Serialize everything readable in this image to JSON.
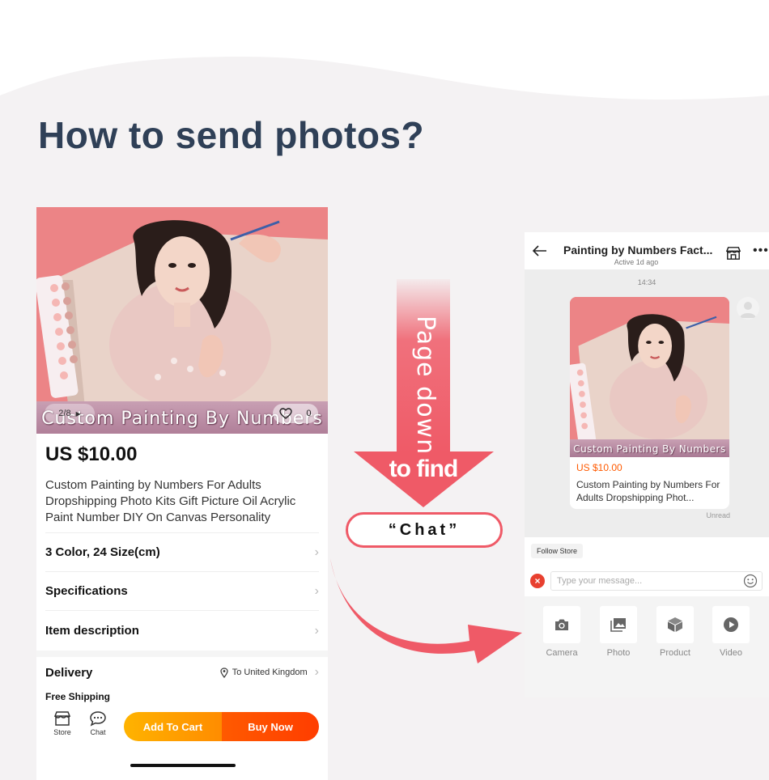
{
  "headline": "How to send photos?",
  "product": {
    "image_banner": "Custom Painting By Numbers",
    "image_counter": "2/8",
    "like_count": "0",
    "price": "US $10.00",
    "title": "Custom Painting by Numbers For Adults Dropshipping Photo Kits Gift Picture Oil Acrylic Paint Number DIY On Canvas Personality",
    "rows": [
      {
        "label": "3 Color, 24 Size(cm)"
      },
      {
        "label": "Specifications"
      },
      {
        "label": "Item description"
      }
    ],
    "delivery": {
      "label": "Delivery",
      "ship_to": "To United Kingdom",
      "free_shipping": "Free Shipping"
    },
    "bottom_bar": {
      "store_label": "Store",
      "chat_label": "Chat",
      "add_to_cart": "Add To Cart",
      "buy_now": "Buy Now"
    }
  },
  "guide": {
    "arrow_text": "Page down",
    "to_find": "to find",
    "chat_pill": "“Chat”"
  },
  "chat": {
    "title": "Painting by Numbers Fact...",
    "status": "Active 1d ago",
    "timestamp": "14:34",
    "card_banner": "Custom Painting By Numbers",
    "card_price": "US $10.00",
    "card_title": "Custom Painting by Numbers For Adults Dropshipping Phot...",
    "unread": "Unread",
    "follow_store": "Follow Store",
    "input_placeholder": "Type your message...",
    "tools": [
      {
        "label": "Camera",
        "icon": "camera-icon"
      },
      {
        "label": "Photo",
        "icon": "photo-icon"
      },
      {
        "label": "Product",
        "icon": "product-icon"
      },
      {
        "label": "Video",
        "icon": "video-icon"
      }
    ]
  },
  "colors": {
    "headline": "#2f4057",
    "arrow": "#ef5a67",
    "add_to_cart": "#ffa000",
    "buy_now": "#ff4a00",
    "price_accent": "#ff5a00"
  }
}
